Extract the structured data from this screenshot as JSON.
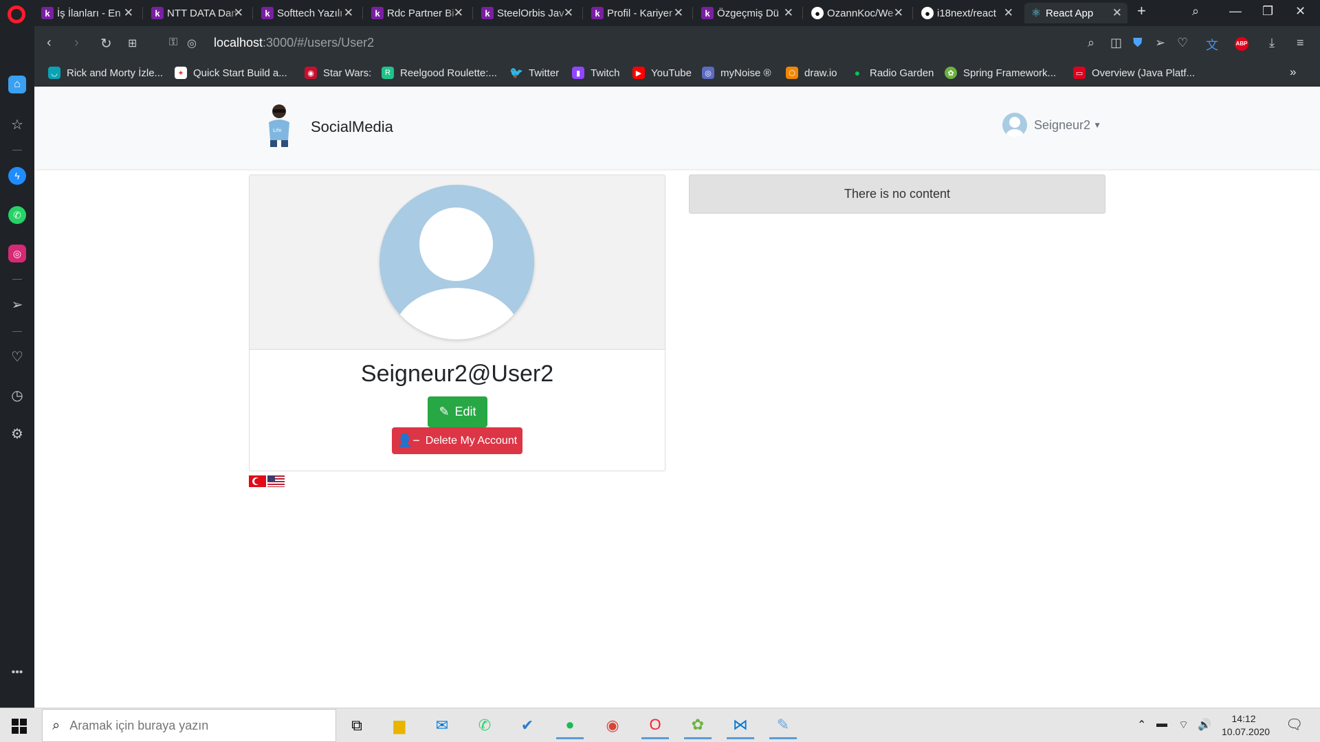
{
  "browser": {
    "tabs": [
      {
        "label": "İş İlanları - En",
        "favicon": "k-logo-icon"
      },
      {
        "label": "NTT DATA Dan",
        "favicon": "k-logo-icon"
      },
      {
        "label": "Softtech Yazılı",
        "favicon": "k-logo-icon"
      },
      {
        "label": "Rdc Partner Bi",
        "favicon": "k-logo-icon"
      },
      {
        "label": "SteelOrbis Jav",
        "favicon": "k-logo-icon"
      },
      {
        "label": "Profil - Kariyer",
        "favicon": "k-logo-icon"
      },
      {
        "label": "Özgeçmiş Dü",
        "favicon": "k-logo-icon"
      },
      {
        "label": "OzannKoc/We",
        "favicon": "github-icon"
      },
      {
        "label": "i18next/react",
        "favicon": "github-icon"
      },
      {
        "label": "React App",
        "favicon": "react-icon",
        "active": true
      }
    ],
    "address": {
      "host": "localhost",
      "path": ":3000/#/users/User2"
    },
    "bookmarks": [
      {
        "label": "Rick and Morty İzle...",
        "color": "#0aa3b5"
      },
      {
        "label": "Quick Start Build a...",
        "color": "#ffffff"
      },
      {
        "label": "Star Wars:",
        "color": "#c8102e"
      },
      {
        "label": "Reelgood Roulette:...",
        "color": "#1fc38a"
      },
      {
        "label": "Twitter",
        "color": "#1da1f2"
      },
      {
        "label": "Twitch",
        "color": "#9146ff"
      },
      {
        "label": "YouTube",
        "color": "#ff0000"
      },
      {
        "label": "myNoise ®",
        "color": "#5c6bc0"
      },
      {
        "label": "draw.io",
        "color": "#f08705"
      },
      {
        "label": "Radio Garden",
        "color": "#00c853"
      },
      {
        "label": "Spring Framework...",
        "color": "#6db33f"
      },
      {
        "label": "Overview (Java Platf...",
        "color": "#e0001b"
      }
    ]
  },
  "app": {
    "brand": "SocialMedia",
    "nav_user": "Seigneur2",
    "profile": {
      "display": "Seigneur2@User2",
      "edit_label": "Edit",
      "delete_label": "Delete My Account"
    },
    "empty_message": "There is no content",
    "flags": [
      "turkey-flag",
      "usa-flag"
    ]
  },
  "taskbar": {
    "search_placeholder": "Aramak için buraya yazın",
    "time": "14:12",
    "date": "10.07.2020"
  }
}
